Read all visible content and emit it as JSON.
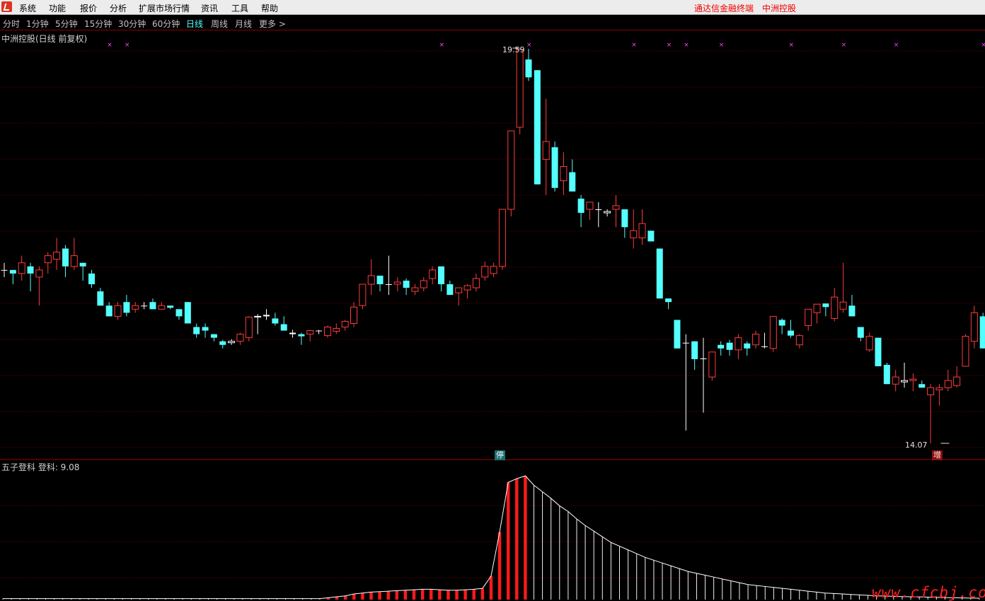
{
  "menu": {
    "items": [
      "系统",
      "功能",
      "报价",
      "分析",
      "扩展市场行情",
      "资讯",
      "工具",
      "帮助"
    ],
    "brand": [
      "通达信金融终端",
      "中洲控股"
    ]
  },
  "periods": {
    "items": [
      "分时",
      "1分钟",
      "5分钟",
      "15分钟",
      "30分钟",
      "60分钟",
      "日线",
      "周线",
      "月线",
      "更多 >"
    ],
    "active": "日线"
  },
  "main": {
    "title": "中洲控股(日线 前复权)",
    "high_label": "19.59",
    "low_label": "14.07",
    "tag_stop": "停",
    "tag_add": "增"
  },
  "indicator": {
    "title": "五子登科  登科: 9.08"
  },
  "watermark": "www.cfcbj.com",
  "colors": {
    "up": "#ff3b3b",
    "down": "#54ffff",
    "flat": "#ffffff",
    "grid": "#6a0000",
    "marker": "#ff40ff"
  },
  "chart_data": [
    {
      "type": "candlestick",
      "title": "中洲控股(日线 前复权)",
      "annotations": {
        "high": 19.59,
        "low": 14.07
      },
      "candles": [
        [
          16.5,
          16.6,
          16.4,
          16.5
        ],
        [
          16.5,
          16.5,
          16.3,
          16.45
        ],
        [
          16.45,
          16.7,
          16.35,
          16.6
        ],
        [
          16.55,
          16.6,
          16.2,
          16.45
        ],
        [
          16.4,
          16.55,
          16.0,
          16.5
        ],
        [
          16.6,
          16.75,
          16.45,
          16.7
        ],
        [
          16.65,
          16.95,
          16.5,
          16.75
        ],
        [
          16.8,
          16.85,
          16.4,
          16.55
        ],
        [
          16.55,
          16.95,
          16.5,
          16.7
        ],
        [
          16.6,
          16.6,
          16.35,
          16.55
        ],
        [
          16.45,
          16.5,
          16.25,
          16.3
        ],
        [
          16.2,
          16.25,
          16.0,
          16.0
        ],
        [
          16.0,
          16.05,
          15.85,
          15.85
        ],
        [
          15.85,
          16.05,
          15.8,
          16.0
        ],
        [
          16.05,
          16.15,
          15.85,
          15.9
        ],
        [
          15.95,
          16.05,
          15.9,
          16.0
        ],
        [
          16.0,
          16.05,
          15.95,
          16.0
        ],
        [
          16.05,
          16.1,
          15.95,
          15.95
        ],
        [
          15.95,
          16.05,
          15.95,
          16.0
        ],
        [
          16.0,
          16.0,
          15.95,
          15.97
        ],
        [
          15.95,
          15.95,
          15.8,
          15.85
        ],
        [
          16.05,
          16.05,
          15.75,
          15.75
        ],
        [
          15.7,
          15.75,
          15.55,
          15.6
        ],
        [
          15.7,
          15.75,
          15.55,
          15.65
        ],
        [
          15.6,
          15.6,
          15.5,
          15.55
        ],
        [
          15.5,
          15.52,
          15.4,
          15.45
        ],
        [
          15.48,
          15.53,
          15.45,
          15.5
        ],
        [
          15.5,
          15.62,
          15.45,
          15.6
        ],
        [
          15.55,
          15.85,
          15.5,
          15.84
        ],
        [
          15.84,
          15.88,
          15.6,
          15.85
        ],
        [
          15.87,
          15.95,
          15.8,
          15.85
        ],
        [
          15.82,
          15.9,
          15.72,
          15.75
        ],
        [
          15.74,
          15.85,
          15.65,
          15.65
        ],
        [
          15.62,
          15.66,
          15.55,
          15.6
        ],
        [
          15.6,
          15.62,
          15.45,
          15.57
        ],
        [
          15.6,
          15.66,
          15.5,
          15.65
        ],
        [
          15.65,
          15.66,
          15.6,
          15.65
        ],
        [
          15.58,
          15.72,
          15.55,
          15.7
        ],
        [
          15.64,
          15.75,
          15.6,
          15.68
        ],
        [
          15.7,
          15.8,
          15.65,
          15.78
        ],
        [
          15.75,
          16.05,
          15.7,
          15.98
        ],
        [
          16.0,
          16.3,
          15.95,
          16.3
        ],
        [
          16.3,
          16.65,
          16.15,
          16.42
        ],
        [
          16.42,
          16.42,
          16.2,
          16.3
        ],
        [
          16.3,
          16.7,
          16.15,
          16.3
        ],
        [
          16.3,
          16.4,
          16.2,
          16.33
        ],
        [
          16.35,
          16.38,
          16.15,
          16.25
        ],
        [
          16.2,
          16.3,
          16.15,
          16.25
        ],
        [
          16.25,
          16.4,
          16.2,
          16.35
        ],
        [
          16.38,
          16.55,
          16.3,
          16.5
        ],
        [
          16.55,
          16.55,
          16.2,
          16.3
        ],
        [
          16.3,
          16.35,
          16.2,
          16.15
        ],
        [
          16.18,
          16.25,
          16.0,
          16.25
        ],
        [
          16.22,
          16.3,
          16.1,
          16.28
        ],
        [
          16.25,
          16.45,
          16.2,
          16.38
        ],
        [
          16.4,
          16.62,
          16.35,
          16.55
        ],
        [
          16.45,
          16.6,
          16.4,
          16.55
        ],
        [
          16.55,
          17.3,
          16.5,
          17.35
        ],
        [
          17.35,
          18.35,
          17.25,
          18.45
        ],
        [
          18.5,
          19.5,
          18.4,
          19.59
        ],
        [
          19.45,
          19.6,
          19.15,
          19.2
        ],
        [
          19.3,
          19.3,
          17.7,
          17.7
        ],
        [
          18.05,
          18.9,
          17.55,
          18.3
        ],
        [
          18.22,
          18.3,
          17.6,
          17.65
        ],
        [
          17.75,
          18.15,
          17.55,
          17.95
        ],
        [
          17.87,
          18.05,
          17.6,
          17.6
        ],
        [
          17.5,
          17.55,
          17.1,
          17.3
        ],
        [
          17.35,
          17.45,
          17.2,
          17.45
        ],
        [
          17.35,
          17.45,
          17.1,
          17.35
        ],
        [
          17.3,
          17.35,
          17.25,
          17.32
        ],
        [
          17.35,
          17.55,
          17.1,
          17.4
        ],
        [
          17.35,
          17.35,
          16.95,
          17.1
        ],
        [
          16.95,
          17.35,
          16.8,
          17.05
        ],
        [
          16.95,
          17.35,
          16.85,
          17.15
        ],
        [
          17.05,
          17.05,
          16.9,
          16.9
        ],
        [
          16.8,
          16.8,
          16.1,
          16.1
        ],
        [
          16.1,
          16.1,
          15.95,
          16.05
        ],
        [
          15.8,
          15.8,
          15.4,
          15.4
        ],
        [
          15.48,
          15.6,
          14.25,
          15.47
        ],
        [
          15.5,
          15.5,
          15.1,
          15.25
        ],
        [
          15.26,
          15.55,
          14.5,
          15.25
        ],
        [
          15.0,
          15.35,
          14.95,
          15.35
        ],
        [
          15.45,
          15.5,
          15.3,
          15.4
        ],
        [
          15.48,
          15.52,
          15.3,
          15.38
        ],
        [
          15.38,
          15.6,
          15.25,
          15.55
        ],
        [
          15.47,
          15.5,
          15.3,
          15.4
        ],
        [
          15.45,
          15.65,
          15.4,
          15.6
        ],
        [
          15.43,
          15.62,
          15.4,
          15.42
        ],
        [
          15.4,
          15.8,
          15.35,
          15.85
        ],
        [
          15.8,
          15.82,
          15.6,
          15.72
        ],
        [
          15.65,
          15.8,
          15.55,
          15.58
        ],
        [
          15.45,
          15.6,
          15.4,
          15.58
        ],
        [
          15.72,
          15.95,
          15.65,
          15.95
        ],
        [
          15.9,
          16.0,
          15.75,
          16.02
        ],
        [
          16.03,
          16.03,
          15.85,
          15.98
        ],
        [
          15.82,
          16.25,
          15.78,
          16.12
        ],
        [
          15.95,
          16.6,
          15.9,
          16.05
        ],
        [
          16.0,
          16.15,
          15.85,
          15.85
        ],
        [
          15.7,
          15.7,
          15.5,
          15.55
        ],
        [
          15.38,
          15.62,
          15.35,
          15.57
        ],
        [
          15.55,
          15.55,
          15.15,
          15.15
        ],
        [
          15.17,
          15.2,
          14.9,
          14.9
        ],
        [
          14.9,
          15.1,
          14.8,
          15.0
        ],
        [
          14.93,
          15.2,
          14.85,
          14.95
        ],
        [
          14.95,
          15.05,
          14.8,
          14.97
        ],
        [
          14.9,
          14.95,
          14.85,
          14.85
        ],
        [
          14.75,
          14.9,
          14.07,
          14.85
        ],
        [
          14.82,
          14.9,
          14.6,
          14.85
        ],
        [
          14.85,
          15.1,
          14.8,
          14.95
        ],
        [
          14.88,
          15.15,
          14.85,
          15.0
        ],
        [
          15.15,
          15.6,
          15.15,
          15.57
        ],
        [
          15.5,
          16.0,
          15.4,
          15.9
        ],
        [
          15.85,
          15.9,
          15.4,
          15.4
        ],
        [
          15.3,
          15.3,
          15.0,
          15.0
        ],
        [
          14.9,
          15.12,
          14.85,
          15.0
        ],
        [
          14.95,
          14.97,
          14.7,
          14.7
        ],
        [
          14.8,
          15.05,
          14.7,
          14.9
        ],
        [
          14.95,
          15.05,
          14.85,
          15.0
        ]
      ],
      "markers_x_index": [
        6,
        7,
        25,
        30,
        36,
        38,
        39,
        41,
        45,
        48,
        51,
        56,
        60,
        61,
        62,
        65,
        68,
        70,
        78,
        79,
        81,
        84,
        86,
        88,
        92,
        95,
        97,
        98,
        99,
        100,
        102,
        104
      ]
    },
    {
      "type": "bar",
      "title": "五子登科",
      "series_name": "登科",
      "last_value": 9.08,
      "values_note": "values increase from near 0, spike near index 56-61, then decay",
      "values": [
        0.1,
        0.1,
        0.1,
        0.1,
        0.1,
        0.1,
        0.1,
        0.1,
        0.1,
        0.1,
        0.1,
        0.1,
        0.1,
        0.1,
        0.1,
        0.1,
        0.1,
        0.1,
        0.1,
        0.1,
        0.1,
        0.1,
        0.1,
        0.1,
        0.1,
        0.1,
        0.1,
        0.1,
        0.1,
        0.1,
        0.1,
        0.1,
        0.1,
        0.1,
        0.1,
        0.1,
        0.1,
        0.1,
        0.2,
        0.3,
        0.4,
        0.6,
        0.7,
        0.8,
        0.85,
        0.9,
        0.95,
        1.0,
        1.05,
        1.1,
        1.1,
        1.05,
        1.0,
        1.0,
        1.05,
        1.1,
        1.2,
        2.5,
        7.2,
        12.5,
        12.9,
        13.2,
        12.2,
        11.5,
        10.8,
        10.0,
        9.4,
        8.6,
        7.9,
        7.3,
        6.7,
        6.1,
        5.7,
        5.3,
        4.9,
        4.5,
        4.2,
        3.9,
        3.6,
        3.3,
        3.0,
        2.8,
        2.6,
        2.4,
        2.2,
        2.0,
        1.8,
        1.6,
        1.5,
        1.4,
        1.3,
        1.2,
        1.1,
        1.0,
        0.9,
        0.8,
        0.7,
        0.65,
        0.6,
        0.55,
        0.5,
        0.45,
        0.4,
        0.38,
        0.35,
        0.32,
        0.3,
        0.28,
        0.26,
        0.24,
        0.22,
        0.2,
        0.18,
        0.16,
        0.15
      ],
      "red_indexes_range": [
        38,
        61
      ]
    }
  ]
}
